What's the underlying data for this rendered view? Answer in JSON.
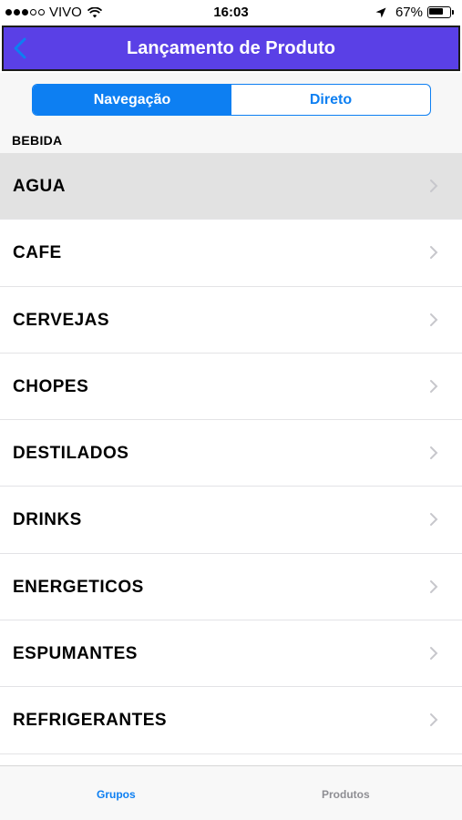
{
  "status_bar": {
    "carrier": "VIVO",
    "time": "16:03",
    "battery_percent": "67%",
    "battery_level": 0.67,
    "signal_bars_filled": 3,
    "signal_bars_total": 5
  },
  "nav": {
    "title": "Lançamento de Produto",
    "back_icon": "chevron-left-icon",
    "bar_color": "#5a40e6"
  },
  "segments": {
    "items": [
      {
        "label": "Navegação",
        "selected": true
      },
      {
        "label": "Direto",
        "selected": false
      }
    ],
    "accent_color": "#0d7ff2"
  },
  "section": {
    "title": "BEBIDA"
  },
  "list": {
    "items": [
      {
        "label": "AGUA",
        "selected": true
      },
      {
        "label": "CAFE"
      },
      {
        "label": "CERVEJAS"
      },
      {
        "label": "CHOPES"
      },
      {
        "label": "DESTILADOS"
      },
      {
        "label": "DRINKS"
      },
      {
        "label": "ENERGETICOS"
      },
      {
        "label": "ESPUMANTES"
      },
      {
        "label": "REFRIGERANTES"
      }
    ]
  },
  "tab_bar": {
    "tabs": [
      {
        "label": "Grupos",
        "selected": true
      },
      {
        "label": "Produtos",
        "selected": false
      }
    ]
  }
}
